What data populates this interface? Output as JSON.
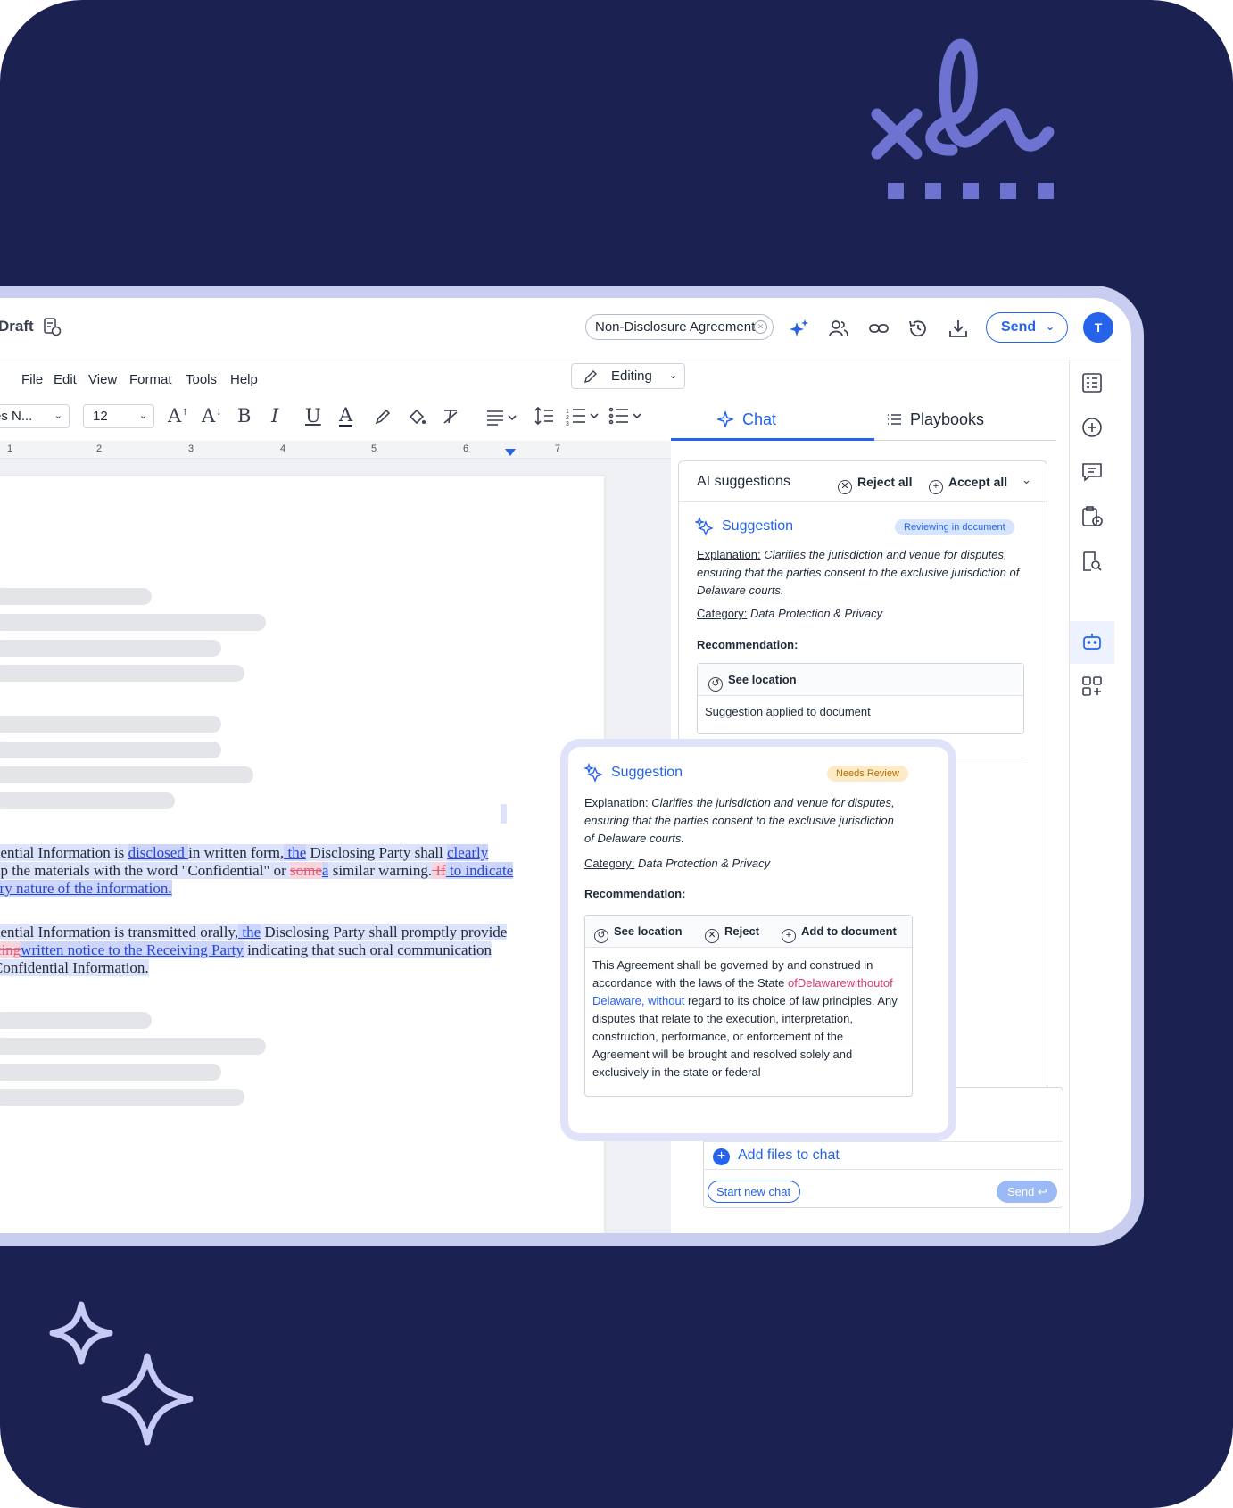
{
  "app": {
    "title": "Draft",
    "document_name": "Non-Disclosure Agreement",
    "send_label": "Send",
    "avatar_initial": "T"
  },
  "menu": [
    "File",
    "Edit",
    "View",
    "Format",
    "Tools",
    "Help"
  ],
  "editing_mode": "Editing",
  "toolbar": {
    "font": "es N...",
    "font_size": "12"
  },
  "ruler": [
    "1",
    "2",
    "3",
    "4",
    "5",
    "6",
    "7"
  ],
  "document": {
    "para1": {
      "line1": [
        "dential Information is ",
        "disclosed ",
        "in written form,",
        " the",
        " Disclosing Party shall ",
        "clearly"
      ],
      "line2": [
        "np the materials with the word \"Confidential\" or ",
        "some",
        "a",
        " similar warning.",
        " If",
        " to indicate"
      ],
      "line3": [
        "ary nature of the information."
      ]
    },
    "para2": {
      "line1": [
        "dential Information is transmitted orally,",
        " the",
        " Disclosing Party shall promptly provide"
      ],
      "line2": [
        "iting",
        "written notice to the Receiving Party",
        " indicating that such oral communication"
      ],
      "line3": [
        "Confidential Information."
      ]
    }
  },
  "panel": {
    "tab_chat": "Chat",
    "tab_playbooks": "Playbooks",
    "ai_suggestions_title": "AI suggestions",
    "reject_all": "Reject all",
    "accept_all": "Accept all",
    "card1": {
      "title": "Suggestion",
      "status": "Reviewing in document",
      "explanation_label": "Explanation:",
      "explanation": "Clarifies the jurisdiction and venue for disputes, ensuring that the parties consent to the exclusive jurisdiction of Delaware courts.",
      "category_label": "Category:",
      "category": "Data Protection & Privacy",
      "recommendation_label": "Recommendation:",
      "see_location": "See location",
      "applied_text": "Suggestion applied to document"
    },
    "add_files": "Add files to chat",
    "start_new_chat": "Start new chat",
    "send": "Send"
  },
  "floating_card": {
    "title": "Suggestion",
    "status": "Needs Review",
    "explanation_label": "Explanation:",
    "explanation": "Clarifies the jurisdiction and venue for disputes, ensuring that the parties consent to the exclusive jurisdiction of Delaware courts.",
    "category_label": "Category:",
    "category": "Data Protection & Privacy",
    "recommendation_label": "Recommendation:",
    "see_location": "See location",
    "reject": "Reject",
    "add_to_document": "Add to document",
    "text_before": "This Agreement shall be governed by and construed in accordance with the laws of the State",
    "text_deleted": "ofDelawarewithoutof",
    "text_inserted": "Delaware, without",
    "text_after": "regard to its choice of law principles. Any disputes that relate to the execution, interpretation, construction, performance, or enforcement of the Agreement will be brought and resolved solely and exclusively in the state or federal"
  },
  "colors": {
    "background": "#1b2251",
    "accent": "#2563eb",
    "frame": "#c9cdef",
    "deleted": "#d63a6b",
    "needs_review": "#fdebc7"
  },
  "icons": [
    "signature-logo-icon",
    "sparkles-icon",
    "ai-sparkle-icon",
    "users-icon",
    "link-icon",
    "history-icon",
    "download-icon",
    "pen-icon",
    "list-icon",
    "bot-icon"
  ]
}
